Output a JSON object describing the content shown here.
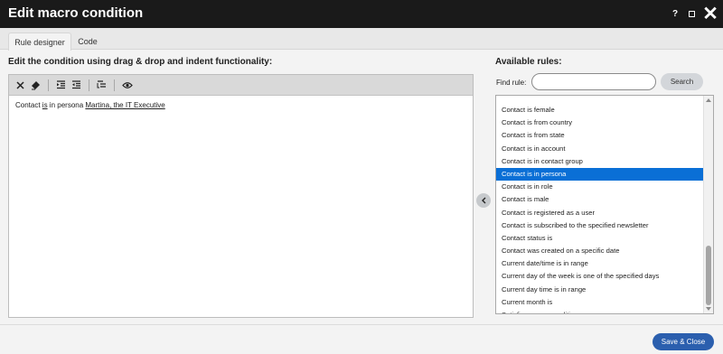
{
  "dialog": {
    "title": "Edit macro condition",
    "help_label": "?",
    "close_label": "✕"
  },
  "tabs": [
    {
      "label": "Rule designer",
      "active": true
    },
    {
      "label": "Code",
      "active": false
    }
  ],
  "editor": {
    "heading": "Edit the condition using drag & drop and indent functionality:",
    "toolbar_icons": [
      "delete-icon",
      "clear-format-icon",
      "indent-decrease-icon",
      "indent-increase-icon",
      "auto-indent-icon",
      "preview-icon"
    ],
    "condition": {
      "prefix": "Contact ",
      "operator": "is",
      "middle": " in persona ",
      "value": "Martina, the IT Executive"
    }
  },
  "rules_panel": {
    "heading": "Available rules:",
    "find_label": "Find rule:",
    "find_value": "",
    "search_button": "Search",
    "selected": "Contact is in persona",
    "items": [
      "Contact is female",
      "Contact is from country",
      "Contact is from state",
      "Contact is in account",
      "Contact is in contact group",
      "Contact is in persona",
      "Contact is in role",
      "Contact is male",
      "Contact is registered as a user",
      "Contact is subscribed to the specified newsletter",
      "Contact status is",
      "Contact was created on a specific date",
      "Current date/time is in range",
      "Current day of the week is one of the specified days",
      "Current day time is in range",
      "Current month is",
      "Satisfies macro condition"
    ]
  },
  "footer": {
    "save_close_label": "Save & Close"
  },
  "colors": {
    "titlebar": "#1a1a1a",
    "selection": "#0a6fd6",
    "primary_button": "#2b5fae"
  }
}
